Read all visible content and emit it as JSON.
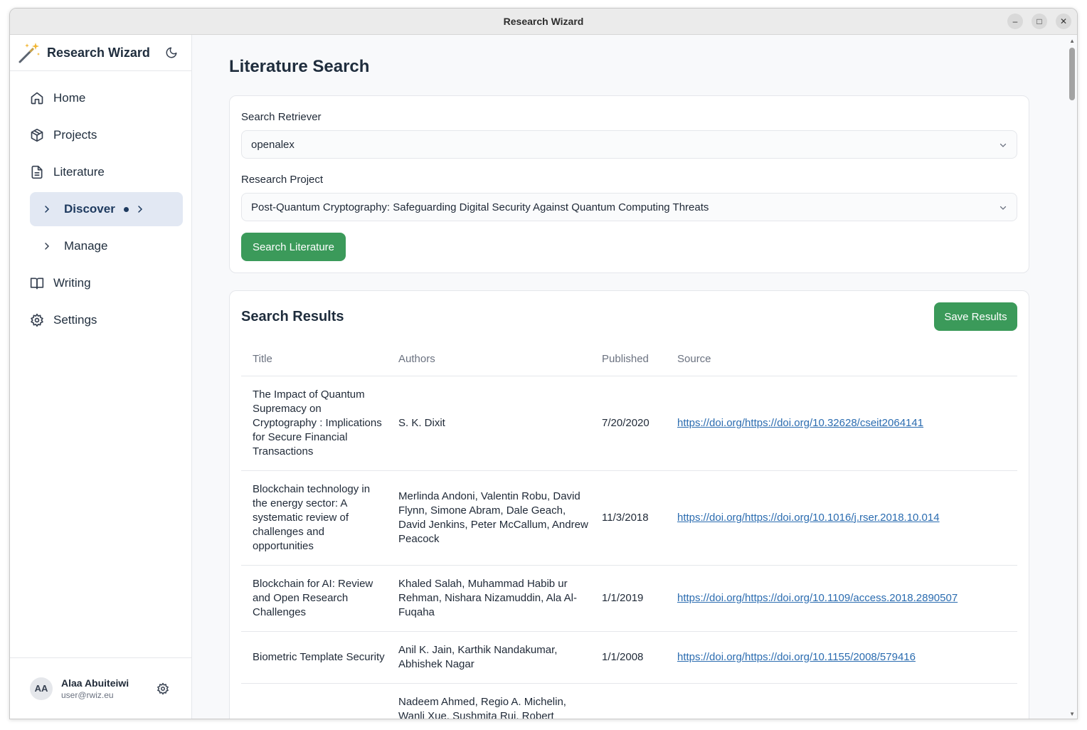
{
  "window": {
    "title": "Research Wizard",
    "controls": {
      "minimize": "–",
      "maximize": "□",
      "close": "✕"
    }
  },
  "sidebar": {
    "brand": "Research Wizard",
    "nav": [
      {
        "label": "Home",
        "icon": "home-icon"
      },
      {
        "label": "Projects",
        "icon": "box-icon"
      },
      {
        "label": "Literature",
        "icon": "document-icon"
      }
    ],
    "sub_items": [
      {
        "label": "Discover",
        "active": true
      },
      {
        "label": "Manage",
        "active": false
      }
    ],
    "nav_bottom": [
      {
        "label": "Writing",
        "icon": "book-icon"
      },
      {
        "label": "Settings",
        "icon": "gear-icon"
      }
    ],
    "user": {
      "initials": "AA",
      "name": "Alaa Abuiteiwi",
      "email": "user@rwiz.eu"
    }
  },
  "main": {
    "title": "Literature Search",
    "search_retriever": {
      "label": "Search Retriever",
      "value": "openalex"
    },
    "research_project": {
      "label": "Research Project",
      "value": "Post-Quantum Cryptography: Safeguarding Digital Security Against Quantum Computing Threats"
    },
    "search_button": "Search Literature",
    "results": {
      "title": "Search Results",
      "save_button": "Save Results",
      "columns": [
        "Title",
        "Authors",
        "Published",
        "Source"
      ],
      "rows": [
        {
          "title": "The Impact of Quantum Supremacy on Cryptography : Implications for Secure Financial Transactions",
          "authors": "S. K. Dixit",
          "published": "7/20/2020",
          "source": "https://doi.org/https://doi.org/10.32628/cseit2064141"
        },
        {
          "title": "Blockchain technology in the energy sector: A systematic review of challenges and opportunities",
          "authors": "Merlinda Andoni, Valentin Robu, David Flynn, Simone Abram, Dale Geach, David Jenkins, Peter McCallum, Andrew Peacock",
          "published": "11/3/2018",
          "source": "https://doi.org/https://doi.org/10.1016/j.rser.2018.10.014"
        },
        {
          "title": "Blockchain for AI: Review and Open Research Challenges",
          "authors": "Khaled Salah, Muhammad Habib ur Rehman, Nishara Nizamuddin, Ala Al-Fuqaha",
          "published": "1/1/2019",
          "source": "https://doi.org/https://doi.org/10.1109/access.2018.2890507"
        },
        {
          "title": "Biometric Template Security",
          "authors": "Anil K. Jain, Karthik Nandakumar, Abhishek Nagar",
          "published": "1/1/2008",
          "source": "https://doi.org/https://doi.org/10.1155/2008/579416"
        },
        {
          "title": "",
          "authors": "Nadeem Ahmed, Regio A. Michelin, Wanli Xue, Sushmita Ruj, Robert",
          "published": "",
          "source": ""
        }
      ]
    }
  },
  "colors": {
    "accent_green": "#3b9a5a",
    "link_blue": "#2b6cb0",
    "active_nav_bg": "#e2e8f3"
  }
}
